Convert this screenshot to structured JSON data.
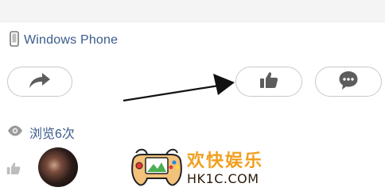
{
  "device": {
    "icon": "phone-icon",
    "label": "Windows Phone"
  },
  "actions": {
    "share_icon": "share-arrow-icon",
    "like_icon": "thumbs-up-icon",
    "comment_icon": "speech-bubble-icon"
  },
  "annotation": {
    "icon": "pointer-arrow",
    "color": "#111111"
  },
  "stats": {
    "views_icon": "eye-icon",
    "views_label": "浏览6次"
  },
  "likers": {
    "icon": "thumbs-up-icon"
  },
  "watermark": {
    "title": "欢快娱乐",
    "domain": "HK1C.COM"
  },
  "colors": {
    "link": "#3a5a8c",
    "icon": "#5d5d5d",
    "watermark": "#f0a020"
  }
}
